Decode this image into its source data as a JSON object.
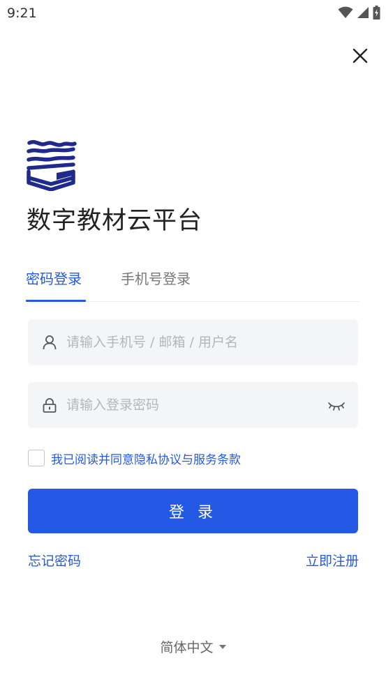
{
  "status_bar": {
    "time": "9:21"
  },
  "app": {
    "title": "数字教材云平台"
  },
  "tabs": [
    {
      "label": "密码登录",
      "active": true
    },
    {
      "label": "手机号登录",
      "active": false
    }
  ],
  "form": {
    "username": {
      "placeholder": "请输入手机号 / 邮箱 / 用户名",
      "value": ""
    },
    "password": {
      "placeholder": "请输入登录密码",
      "value": ""
    },
    "agreement": {
      "text": "我已阅读并同意隐私协议与服务条款",
      "checked": false
    },
    "login_label": "登 录"
  },
  "links": {
    "forgot": "忘记密码",
    "register": "立即注册"
  },
  "language": {
    "selected": "简体中文"
  },
  "colors": {
    "accent": "#2459e5",
    "logo": "#1f2a8c",
    "field_bg": "#f4f5f7"
  },
  "icons": [
    "wifi-icon",
    "signal-icon",
    "battery-icon",
    "close-icon",
    "user-icon",
    "lock-icon",
    "eye-closed-icon",
    "chevron-down-icon"
  ]
}
